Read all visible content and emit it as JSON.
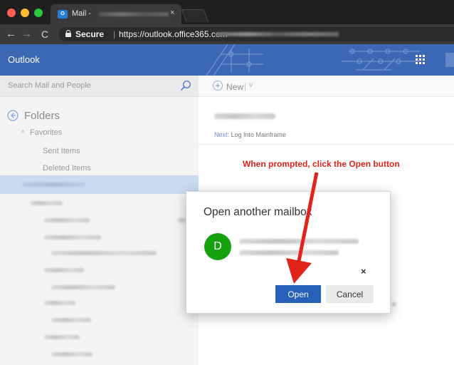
{
  "browser": {
    "tab_title": "Mail -",
    "tab_close": "×",
    "tab_favicon_text": "O",
    "nav_back": "←",
    "nav_forward": "→",
    "nav_reload": "C",
    "secure_label": "Secure",
    "separator": "|",
    "url": "https://outlook.office365.com"
  },
  "owa": {
    "app_title": "Outlook",
    "header_color": "#3b67b4"
  },
  "sidebar": {
    "search_placeholder": "Search Mail and People",
    "folders_label": "Folders",
    "favorites_chevron": "^",
    "favorites_label": "Favorites",
    "sent_items": "Sent Items",
    "deleted_items": "Deleted Items"
  },
  "toolbar": {
    "new_plus": "+",
    "new_label": "New",
    "new_separator": "|",
    "new_chevron": "v"
  },
  "reading": {
    "next_prefix": "Next:",
    "next_text": " Log Into Mainframe"
  },
  "annotation": {
    "text": "When prompted, click the Open button",
    "color": "#e2231a"
  },
  "modal": {
    "title": "Open another mailbox",
    "avatar_letter": "D",
    "avatar_color": "#13a10e",
    "close_glyph": "×",
    "open_label": "Open",
    "cancel_label": "Cancel"
  }
}
